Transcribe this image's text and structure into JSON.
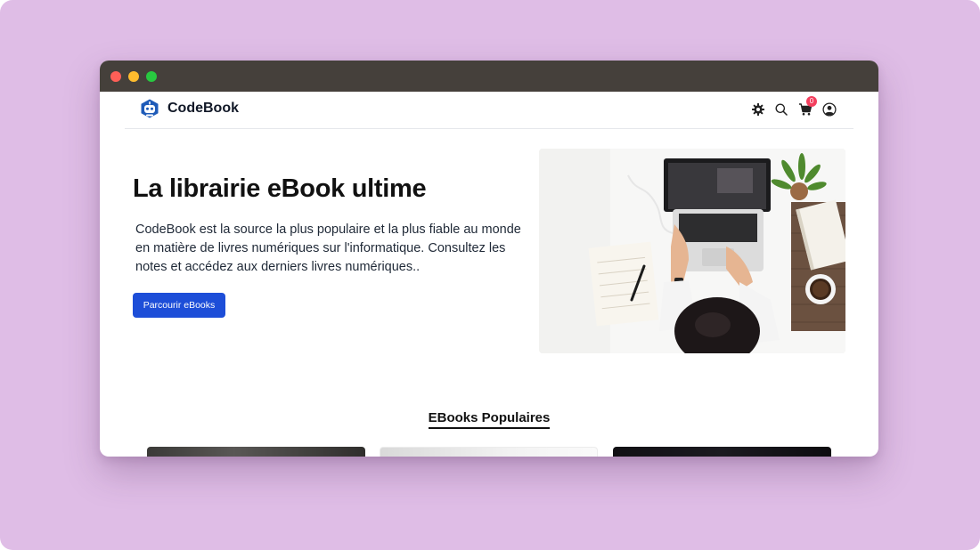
{
  "brand": {
    "name": "CodeBook",
    "logo_icon": "codebook-robot-logo",
    "accent_color": "#1e5bb8"
  },
  "nav": {
    "icons": [
      "settings-icon",
      "search-icon",
      "cart-icon",
      "user-icon"
    ],
    "cart_count": "0",
    "badge_color": "#f43f5e"
  },
  "hero": {
    "title": "La librairie eBook ultime",
    "description": "CodeBook est la source la plus populaire et la plus fiable au monde en matière de livres numériques sur l'informatique. Consultez les notes et accédez aux derniers livres numériques..",
    "cta_label": "Parcourir eBooks",
    "cta_color": "#1d4ed8",
    "image_icon": "laptop-desk-photo"
  },
  "popular": {
    "title": "EBooks Populaires",
    "cards": [
      "ebook-card-1",
      "ebook-card-2",
      "ebook-card-3"
    ]
  },
  "window_controls": {
    "colors": [
      "#fe5f57",
      "#febc2e",
      "#28c840"
    ]
  },
  "background_color": "#dfbde6"
}
